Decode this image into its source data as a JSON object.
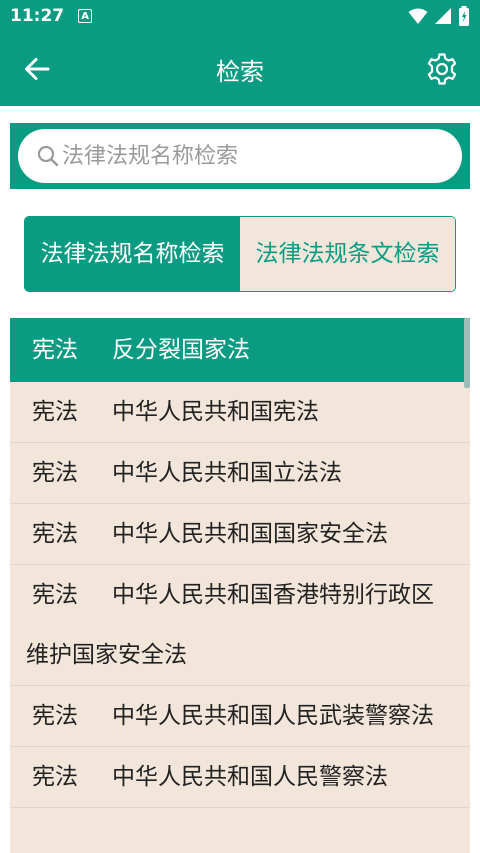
{
  "status_bar": {
    "time": "11:27",
    "notif_letter": "A",
    "icons": [
      "wifi-icon",
      "signal-icon",
      "battery-icon"
    ]
  },
  "app_bar": {
    "title": "检索",
    "back_icon": "arrow-left-icon",
    "settings_icon": "gear-icon"
  },
  "search": {
    "placeholder": "法律法规名称检索",
    "value": ""
  },
  "tabs": [
    {
      "label": "法律法规名称检索",
      "active": true
    },
    {
      "label": "法律法规条文检索",
      "active": false
    }
  ],
  "results": [
    {
      "category": "宪法",
      "title": "反分裂国家法"
    },
    {
      "category": "宪法",
      "title": "中华人民共和国宪法"
    },
    {
      "category": "宪法",
      "title": "中华人民共和国立法法"
    },
    {
      "category": "宪法",
      "title": "中华人民共和国国家安全法"
    },
    {
      "category": "宪法",
      "title": "中华人民共和国香港特别行政区维护国家安全法"
    },
    {
      "category": "宪法",
      "title": "中华人民共和国人民武装警察法"
    },
    {
      "category": "宪法",
      "title": "中华人民共和国人民警察法"
    }
  ],
  "colors": {
    "primary": "#0a9b83",
    "list_bg": "#f2e6da",
    "text": "#222222"
  }
}
